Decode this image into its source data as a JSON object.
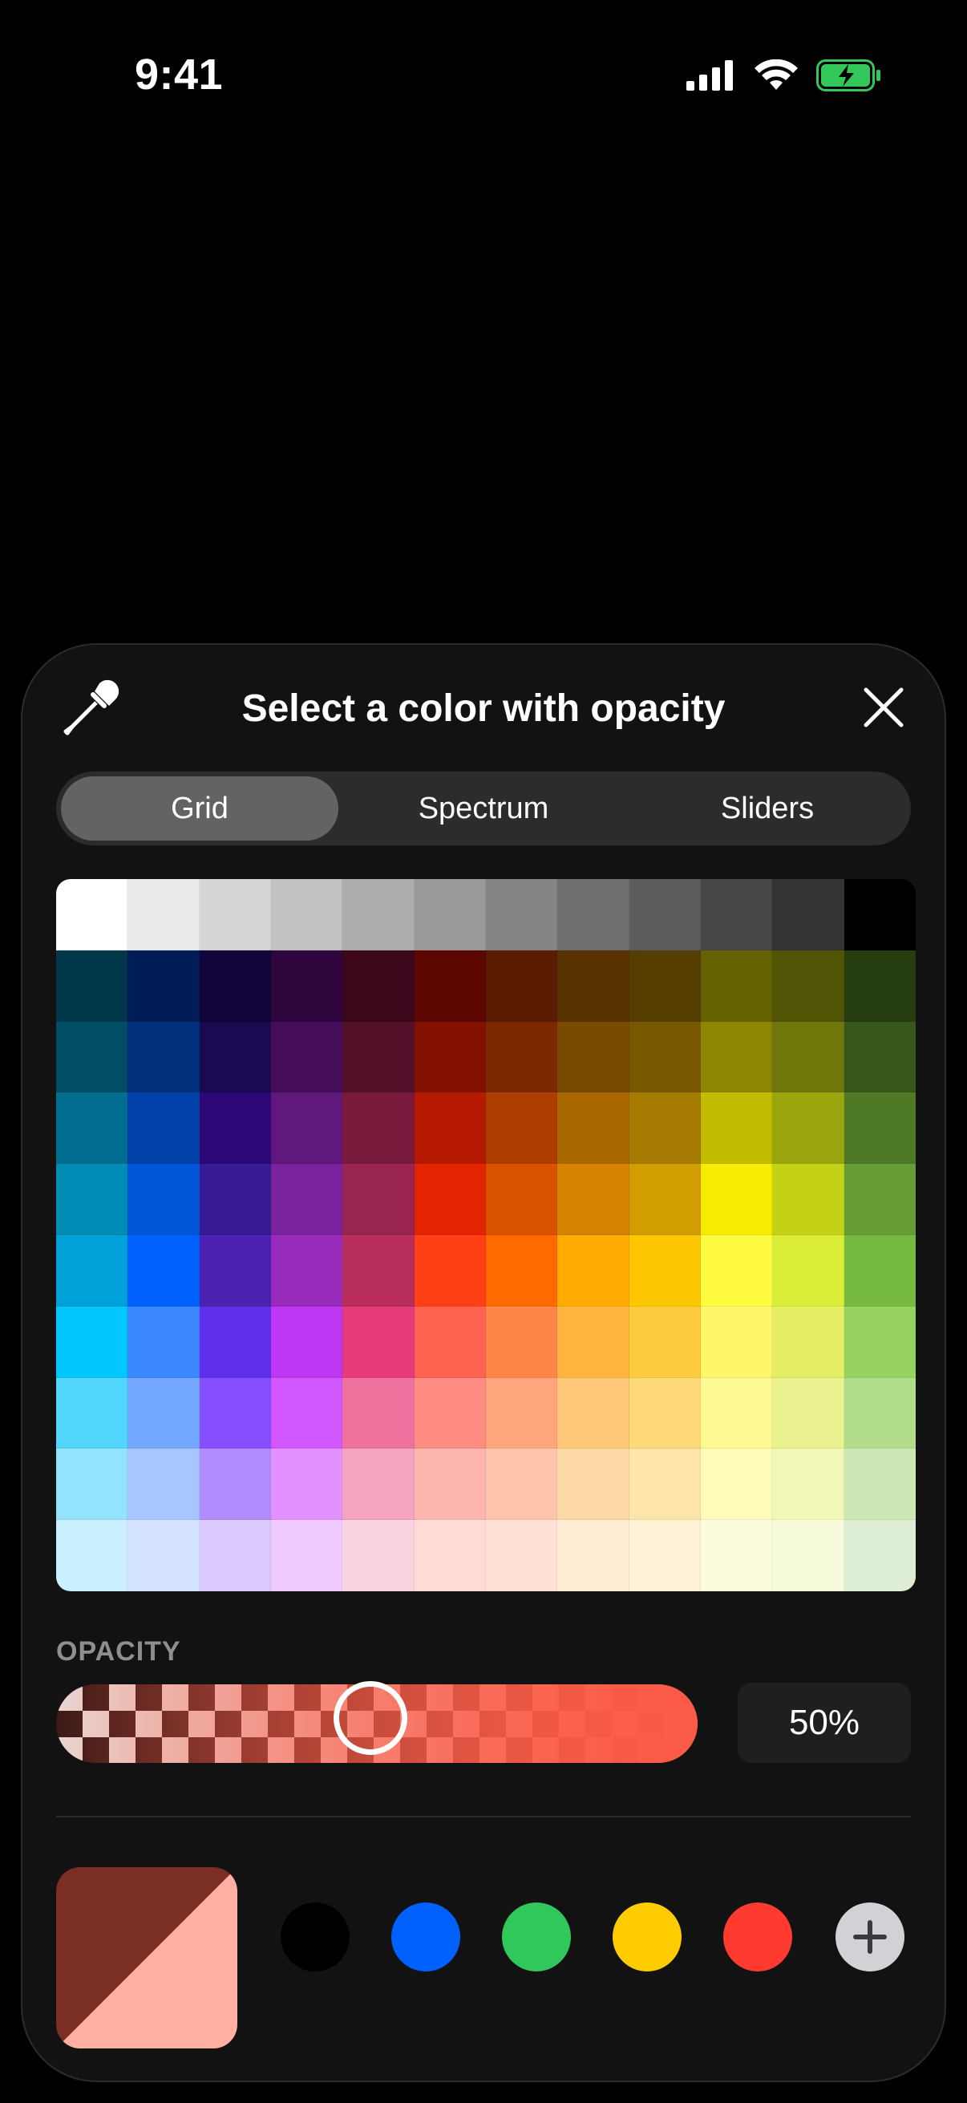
{
  "status_bar": {
    "time": "9:41",
    "icons": [
      "signal-icon",
      "wifi-icon",
      "battery-charging-icon"
    ],
    "battery_color": "#34c759"
  },
  "sheet": {
    "title": "Select a color with opacity",
    "eyedropper_icon": "eyedropper-icon",
    "close_icon": "close-icon",
    "tabs": [
      {
        "label": "Grid",
        "active": true
      },
      {
        "label": "Spectrum",
        "active": false
      },
      {
        "label": "Sliders",
        "active": false
      }
    ],
    "grid_colors": [
      [
        "#ffffff",
        "#ebebeb",
        "#d6d6d6",
        "#c2c2c2",
        "#adadad",
        "#999999",
        "#858585",
        "#707070",
        "#5c5c5c",
        "#474747",
        "#333333",
        "#000000"
      ],
      [
        "#00374a",
        "#011d57",
        "#11053b",
        "#2e063d",
        "#3c071b",
        "#5c0701",
        "#5a1c00",
        "#583300",
        "#563d00",
        "#666100",
        "#4f5504",
        "#263e0f"
      ],
      [
        "#004d65",
        "#012f7b",
        "#1a0a52",
        "#450d59",
        "#551029",
        "#831100",
        "#7b2900",
        "#7a4a00",
        "#785800",
        "#8c8602",
        "#6f760a",
        "#38571a"
      ],
      [
        "#016e8f",
        "#0042a9",
        "#2c0977",
        "#61187c",
        "#791a3d",
        "#b51a00",
        "#ad3e00",
        "#a96800",
        "#a67b01",
        "#c4bc00",
        "#9ba50e",
        "#4e7a27"
      ],
      [
        "#008cb4",
        "#0056d6",
        "#371a94",
        "#7a219e",
        "#99244f",
        "#e22400",
        "#da5100",
        "#d38301",
        "#d19d01",
        "#f5ec00",
        "#c3d117",
        "#669d34"
      ],
      [
        "#00a1d8",
        "#0061fe",
        "#4d22b2",
        "#982abc",
        "#b92d5d",
        "#ff4015",
        "#ff6a00",
        "#ffab01",
        "#fcc700",
        "#fefb41",
        "#d9ec37",
        "#76bb40"
      ],
      [
        "#01c7fc",
        "#3a87fe",
        "#5e30eb",
        "#be38f3",
        "#e63b7a",
        "#fe6250",
        "#fe8648",
        "#feb43f",
        "#fecb3e",
        "#fff76b",
        "#e4ef65",
        "#96d35f"
      ],
      [
        "#52d6fc",
        "#74a7ff",
        "#864ffd",
        "#d357fe",
        "#ee719e",
        "#ff8c82",
        "#fea57d",
        "#fec777",
        "#fed977",
        "#fff994",
        "#eaf28f",
        "#b1dd8b"
      ],
      [
        "#93e3fc",
        "#a7c6ff",
        "#b18cfe",
        "#e292fe",
        "#f4a4c0",
        "#ffb5af",
        "#ffc5ab",
        "#fed9a8",
        "#fde4a8",
        "#fffbb9",
        "#f1f7b7",
        "#cde8b5"
      ],
      [
        "#cbf0ff",
        "#d3e2ff",
        "#d9c9fe",
        "#efcaff",
        "#f9d3e0",
        "#ffdbd8",
        "#ffe2d6",
        "#feecd4",
        "#fef1d5",
        "#fdfbdd",
        "#f6fadb",
        "#deeed4"
      ]
    ],
    "opacity": {
      "label": "OPACITY",
      "value": 0.5,
      "value_text": "50%",
      "tint_color": "#ff5a45"
    },
    "current_color": {
      "base": "#7b2e24",
      "with_opacity": "#ffb0a2"
    },
    "swatches": [
      {
        "name": "black",
        "color": "#000000"
      },
      {
        "name": "blue",
        "color": "#0061fe"
      },
      {
        "name": "green",
        "color": "#30c75b"
      },
      {
        "name": "yellow",
        "color": "#ffcc00"
      },
      {
        "name": "red",
        "color": "#ff3b30"
      }
    ],
    "add_icon": "plus-icon"
  }
}
